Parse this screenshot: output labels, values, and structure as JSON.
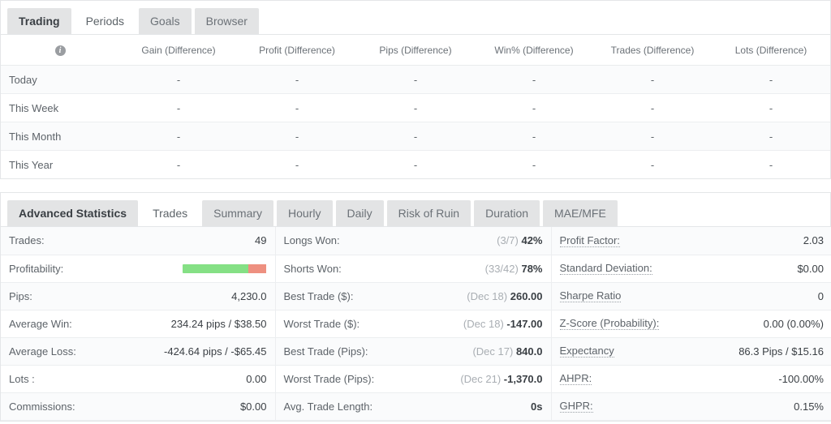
{
  "periods_panel": {
    "tabs": [
      {
        "label": "Trading",
        "active": false,
        "bold": true
      },
      {
        "label": "Periods",
        "active": true,
        "bold": false
      },
      {
        "label": "Goals",
        "active": false,
        "bold": false
      },
      {
        "label": "Browser",
        "active": false,
        "bold": false
      }
    ],
    "header_icon": "info-icon",
    "header_icon_glyph": "i",
    "columns": [
      "Gain (Difference)",
      "Profit (Difference)",
      "Pips (Difference)",
      "Win% (Difference)",
      "Trades (Difference)",
      "Lots (Difference)"
    ],
    "rows": [
      {
        "label": "Today",
        "values": [
          "-",
          "-",
          "-",
          "-",
          "-",
          "-"
        ]
      },
      {
        "label": "This Week",
        "values": [
          "-",
          "-",
          "-",
          "-",
          "-",
          "-"
        ]
      },
      {
        "label": "This Month",
        "values": [
          "-",
          "-",
          "-",
          "-",
          "-",
          "-"
        ]
      },
      {
        "label": "This Year",
        "values": [
          "-",
          "-",
          "-",
          "-",
          "-",
          "-"
        ]
      }
    ]
  },
  "stats_panel": {
    "tabs": [
      {
        "label": "Advanced Statistics",
        "active": false,
        "bold": true
      },
      {
        "label": "Trades",
        "active": true,
        "bold": false
      },
      {
        "label": "Summary",
        "active": false,
        "bold": false
      },
      {
        "label": "Hourly",
        "active": false,
        "bold": false
      },
      {
        "label": "Daily",
        "active": false,
        "bold": false
      },
      {
        "label": "Risk of Ruin",
        "active": false,
        "bold": false
      },
      {
        "label": "Duration",
        "active": false,
        "bold": false
      },
      {
        "label": "MAE/MFE",
        "active": false,
        "bold": false
      }
    ],
    "col1": [
      {
        "label": "Trades:",
        "value": "49"
      },
      {
        "label": "Profitability:",
        "value": "",
        "bar": {
          "win_pct": 78,
          "loss_pct": 22,
          "win_color": "#85e085",
          "loss_color": "#ee9080"
        }
      },
      {
        "label": "Pips:",
        "value": "4,230.0"
      },
      {
        "label": "Average Win:",
        "value": "234.24 pips / $38.50"
      },
      {
        "label": "Average Loss:",
        "value": "-424.64 pips / -$65.45"
      },
      {
        "label": "Lots :",
        "value": "0.00"
      },
      {
        "label": "Commissions:",
        "value": "$0.00"
      }
    ],
    "col2": [
      {
        "label": "Longs Won:",
        "muted": "(3/7)",
        "value": "42%"
      },
      {
        "label": "Shorts Won:",
        "muted": "(33/42)",
        "value": "78%"
      },
      {
        "label": "Best Trade ($):",
        "muted": "(Dec 18)",
        "value": "260.00"
      },
      {
        "label": "Worst Trade ($):",
        "muted": "(Dec 18)",
        "value": "-147.00"
      },
      {
        "label": "Best Trade (Pips):",
        "muted": "(Dec 17)",
        "value": "840.0"
      },
      {
        "label": "Worst Trade (Pips):",
        "muted": "(Dec 21)",
        "value": "-1,370.0"
      },
      {
        "label": "Avg. Trade Length:",
        "muted": "",
        "value": "0s"
      }
    ],
    "col3": [
      {
        "label": "Profit Factor:",
        "value": "2.03"
      },
      {
        "label": "Standard Deviation:",
        "value": "$0.00"
      },
      {
        "label": "Sharpe Ratio",
        "value": "0"
      },
      {
        "label": "Z-Score (Probability):",
        "value": "0.00 (0.00%)"
      },
      {
        "label": "Expectancy",
        "value": "86.3 Pips / $15.16"
      },
      {
        "label": "AHPR:",
        "value": "-100.00%"
      },
      {
        "label": "GHPR:",
        "value": "0.15%"
      }
    ]
  }
}
